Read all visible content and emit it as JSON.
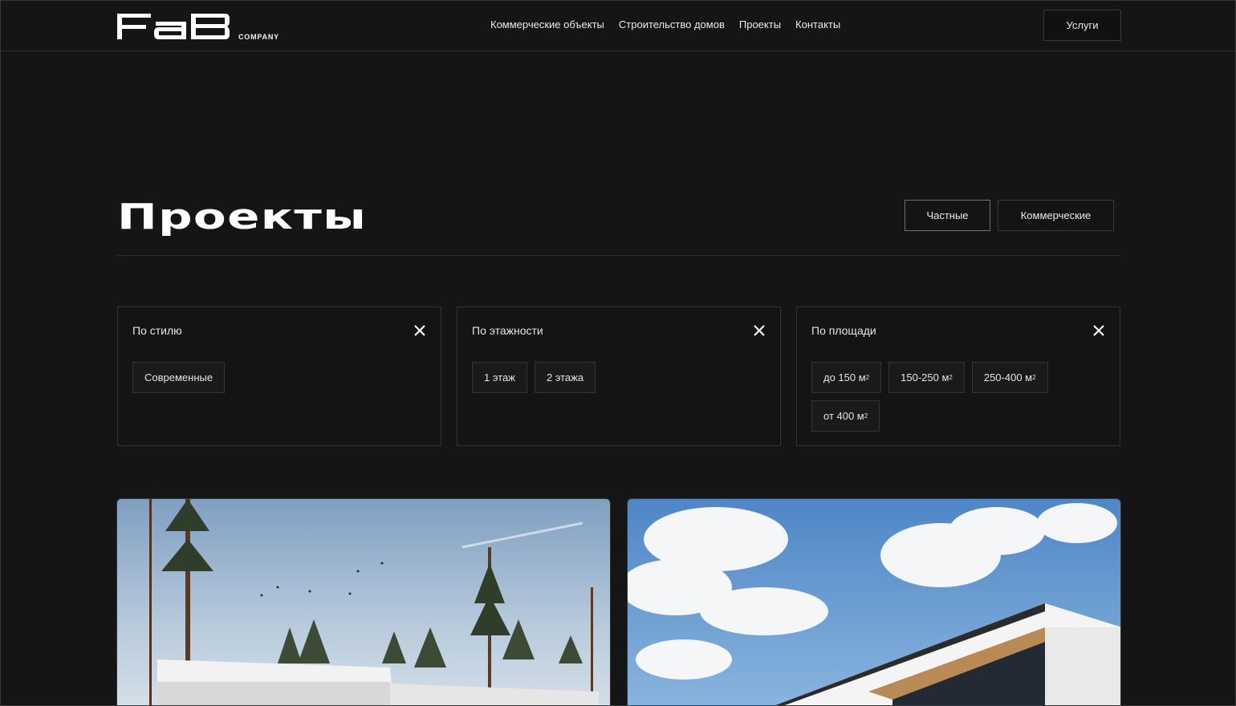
{
  "header": {
    "logo_text": "FAB",
    "logo_sub": "COMPANY",
    "nav": [
      {
        "label": "Коммерческие объекты"
      },
      {
        "label": "Строительство домов"
      },
      {
        "label": "Проекты"
      },
      {
        "label": "Контакты"
      }
    ],
    "services_label": "Услуги"
  },
  "page": {
    "title": "Проекты",
    "tabs": [
      {
        "label": "Частные",
        "active": true
      },
      {
        "label": "Коммерческие",
        "active": false
      }
    ]
  },
  "filters": [
    {
      "title": "По стилю",
      "options": [
        "Современные"
      ]
    },
    {
      "title": "По этажности",
      "options": [
        "1 этаж",
        "2 этажа"
      ]
    },
    {
      "title": "По площади",
      "options": [
        {
          "text": "до 150 м",
          "sup": "2"
        },
        {
          "text": "150-250 м",
          "sup": "2"
        },
        {
          "text": "250-400 м",
          "sup": "2"
        },
        {
          "text": "от 400 м",
          "sup": "2"
        }
      ]
    }
  ],
  "colors": {
    "background": "#151515",
    "accent_border": "#5b6fa8",
    "text": "#e8e8e8"
  }
}
